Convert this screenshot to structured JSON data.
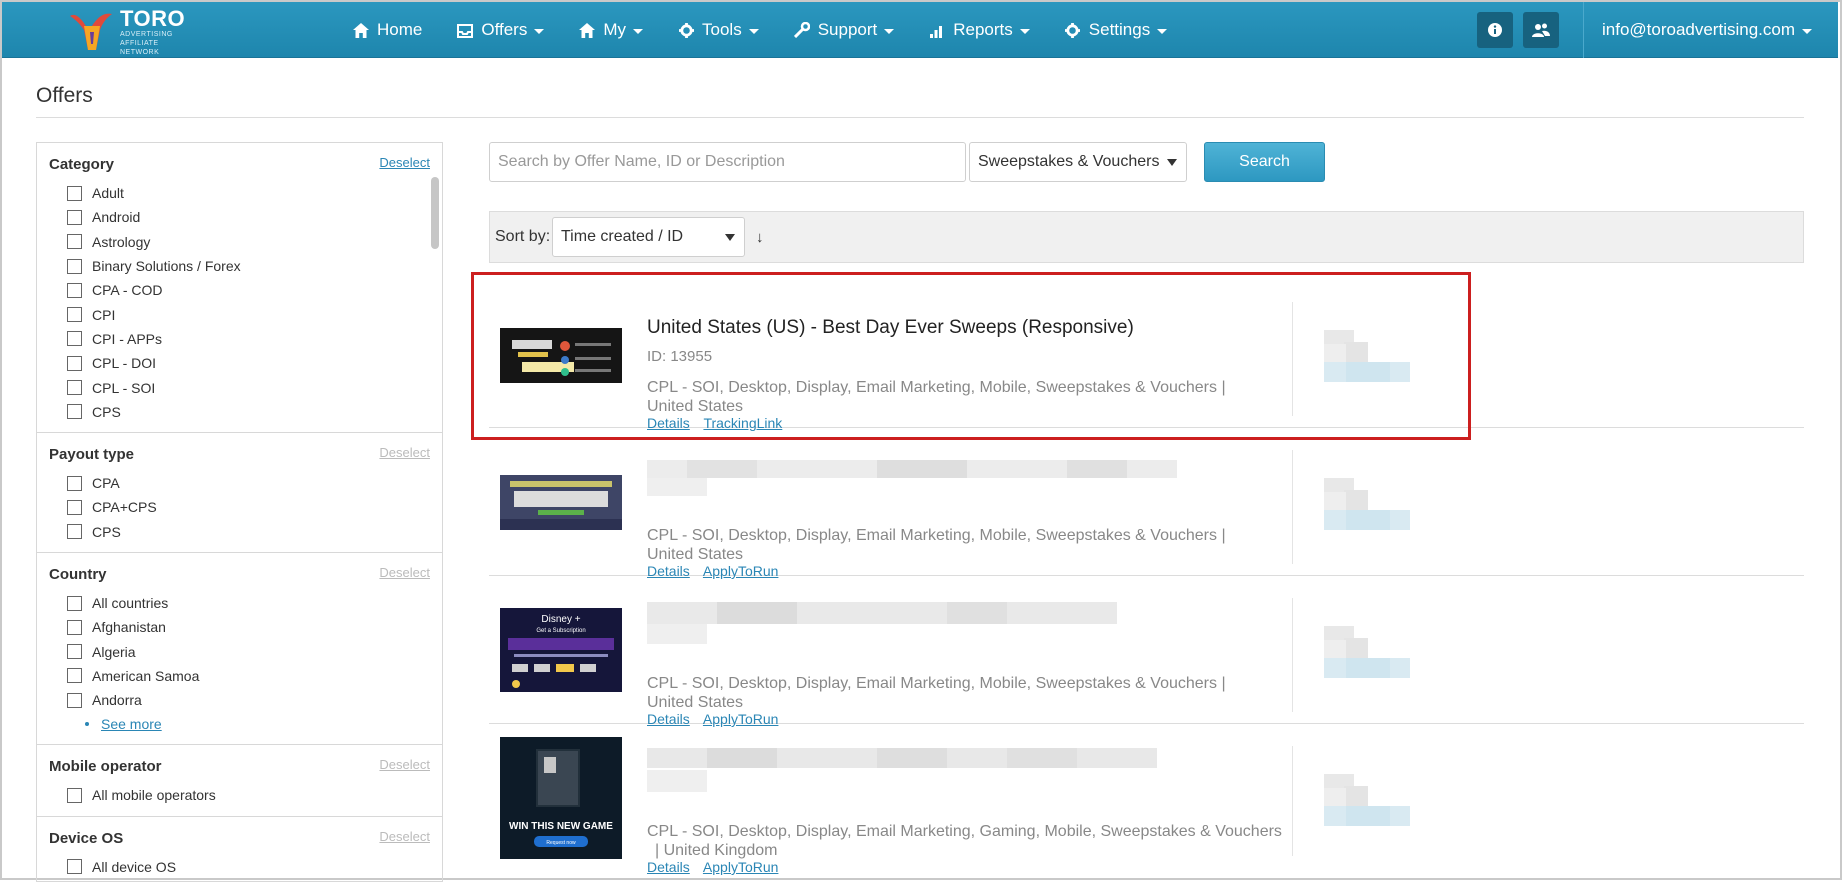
{
  "brand": {
    "name": "TORO",
    "tagline": "ADVERTISING",
    "sub": "AFFILIATE NETWORK"
  },
  "nav": [
    {
      "label": "Home",
      "icon": "home-icon",
      "caret": false
    },
    {
      "label": "Offers",
      "icon": "offers-icon",
      "caret": true
    },
    {
      "label": "My",
      "icon": "home-icon",
      "caret": true
    },
    {
      "label": "Tools",
      "icon": "gear-icon",
      "caret": true
    },
    {
      "label": "Support",
      "icon": "wrench-icon",
      "caret": true
    },
    {
      "label": "Reports",
      "icon": "bar-chart-icon",
      "caret": true
    },
    {
      "label": "Settings",
      "icon": "gear-icon",
      "caret": true
    }
  ],
  "user": {
    "email": "info@toroadvertising.com"
  },
  "page": {
    "title": "Offers"
  },
  "filters": {
    "category": {
      "title": "Category",
      "deselect": "Deselect",
      "options": [
        "Adult",
        "Android",
        "Astrology",
        "Binary Solutions / Forex",
        "CPA - COD",
        "CPI",
        "CPI - APPs",
        "CPL - DOI",
        "CPL - SOI",
        "CPS"
      ]
    },
    "payout": {
      "title": "Payout type",
      "deselect": "Deselect",
      "options": [
        "CPA",
        "CPA+CPS",
        "CPS"
      ]
    },
    "country": {
      "title": "Country",
      "deselect": "Deselect",
      "options": [
        "All countries",
        "Afghanistan",
        "Algeria",
        "American Samoa",
        "Andorra"
      ],
      "see_more": "See more"
    },
    "mobile": {
      "title": "Mobile operator",
      "deselect": "Deselect",
      "options": [
        "All mobile operators"
      ]
    },
    "device": {
      "title": "Device OS",
      "deselect": "Deselect",
      "options": [
        "All device OS"
      ]
    }
  },
  "search": {
    "placeholder": "Search by Offer Name, ID or Description",
    "category_value": "Sweepstakes & Vouchers",
    "button": "Search"
  },
  "sort": {
    "label": "Sort by:",
    "value": "Time created / ID",
    "direction": "↓"
  },
  "offers": [
    {
      "title": "United States (US) - Best Day Ever Sweeps (Responsive)",
      "id_label": "ID: 13955",
      "categories": "CPL - SOI, Desktop, Display, Email Marketing, Mobile, Sweepstakes & Vouchers   |",
      "country": "United States",
      "links": [
        "Details",
        "TrackingLink"
      ]
    },
    {
      "categories": "CPL - SOI, Desktop, Display, Email Marketing, Mobile, Sweepstakes & Vouchers   |",
      "country": "United States",
      "links": [
        "Details",
        "ApplyToRun"
      ]
    },
    {
      "categories": "CPL - SOI, Desktop, Display, Email Marketing, Mobile, Sweepstakes & Vouchers   |",
      "country": "United States",
      "links": [
        "Details",
        "ApplyToRun"
      ]
    },
    {
      "categories": "CPL - SOI, Desktop, Display, Email Marketing, Gaming, Mobile, Sweepstakes & Vouchers",
      "country": "|   United Kingdom",
      "links": [
        "Details",
        "ApplyToRun"
      ]
    }
  ],
  "thumbs": {
    "t3_brand": "Disney +",
    "t3_sub": "Get a Subscription",
    "t4_text": "WIN THIS NEW GAME",
    "t4_btn": "Request now"
  },
  "colors": {
    "navbar": "#2390b8",
    "link": "#2a86b5",
    "highlight": "#cc1f1f",
    "search_btn": "#3aa5cc"
  }
}
